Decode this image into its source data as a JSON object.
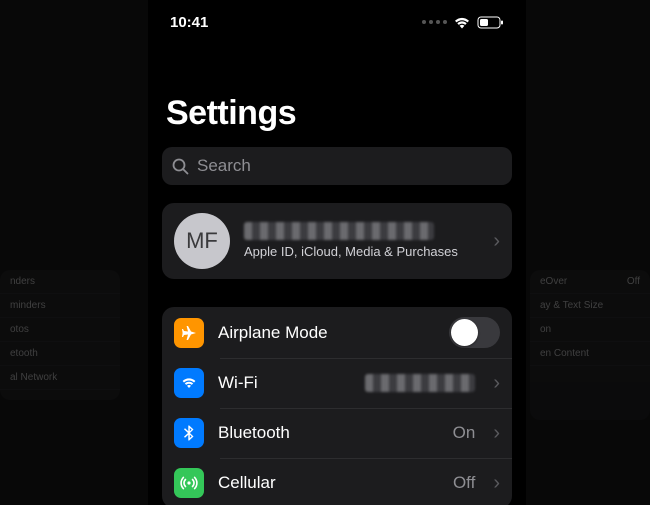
{
  "status": {
    "time": "10:41"
  },
  "title": "Settings",
  "search": {
    "placeholder": "Search"
  },
  "profile": {
    "initials": "MF",
    "subtitle": "Apple ID, iCloud, Media & Purchases"
  },
  "rows": {
    "airplane": {
      "label": "Airplane Mode",
      "on": false
    },
    "wifi": {
      "label": "Wi-Fi"
    },
    "bluetooth": {
      "label": "Bluetooth",
      "value": "On"
    },
    "cellular": {
      "label": "Cellular",
      "value": "Off"
    }
  },
  "bg_left": [
    "nders",
    "minders",
    "otos",
    "etooth",
    "al Network"
  ],
  "bg_right": [
    {
      "l": "eOver",
      "v": "Off"
    },
    {
      "l": "ay & Text Size",
      "v": ""
    },
    {
      "l": "on",
      "v": ""
    },
    {
      "l": "en Content",
      "v": ""
    }
  ]
}
